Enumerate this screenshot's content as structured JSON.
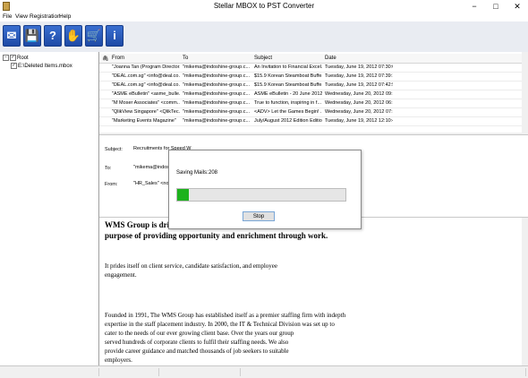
{
  "window": {
    "title": "Stellar MBOX to PST Converter",
    "minimize": "−",
    "maximize": "□",
    "close": "✕"
  },
  "menu": [
    "File",
    "View",
    "Registration",
    "Help"
  ],
  "toolbar": [
    {
      "name": "email-icon",
      "glyph": "✉"
    },
    {
      "name": "save-icon",
      "glyph": "💾"
    },
    {
      "name": "help-icon",
      "glyph": "?"
    },
    {
      "name": "hand-icon",
      "glyph": "✋"
    },
    {
      "name": "cart-icon",
      "glyph": "🛒"
    },
    {
      "name": "info-icon",
      "glyph": "i"
    }
  ],
  "tree": {
    "root": "Root",
    "child": "E:\\Deleted Items.mbox"
  },
  "list": {
    "columns": [
      "From",
      "To",
      "Subject",
      "Date"
    ],
    "rows": [
      [
        "\"Joanna Tan (Program Director...",
        "\"mikema@indoshine-group.c...",
        "An Invitation to Financial Excel...",
        "Tuesday, June 19, 2012 07:30:08"
      ],
      [
        "\"DEAL.com.sg\" <info@deal.co...",
        "\"mikema@indoshine-group.c...",
        "$15.9 Korean Steamboat Buffe...",
        "Tuesday, June 19, 2012 07:39:19"
      ],
      [
        "\"DEAL.com.sg\" <info@deal.co...",
        "\"mikema@indoshine-group.c...",
        "$15.9 Korean Steamboat Buffe...",
        "Tuesday, June 19, 2012 07:42:59"
      ],
      [
        "\"ASME eBulletin\" <asme_bulle...",
        "\"mikema@indoshine-group.c...",
        "ASME eBulletin - 20 June 2012",
        "Wednesday, June 20, 2012 09:5..."
      ],
      [
        "\"M Moser Associates\" <comm...",
        "\"mikema@indoshine-group.c...",
        "True to function, inspiring in f...",
        "Wednesday, June 20, 2012 06:3..."
      ],
      [
        "\"QlikView Singapore\" <QlikTec...",
        "\"mikema@indoshine-group.c...",
        "<ADV> Let the Games Begin! ...",
        "Wednesday, June 20, 2012 07:3..."
      ],
      [
        "\"Marketing Events Magazine\"",
        "\"mikema@indoshine-group.c...",
        "July/August 2012 Edition Editio...",
        "Tuesday, June 19, 2012 12:10:43"
      ]
    ]
  },
  "preview": {
    "subject_label": "Subject:",
    "subject_value": "Recruitments for Speed W",
    "to_label": "To:",
    "to_value": "\"mikema@indoshine",
    "from_label": "From:",
    "from_value": "\"HR_Sales\" <noreply"
  },
  "body": {
    "heading1": "WMS Group is driven by passion and a single",
    "heading2": "purpose of providing opportunity and enrichment through work.",
    "p1a": "It prides itself on client service, candidate satisfaction, and employee",
    "p1b": "engagement.",
    "p2a": "Founded in 1991, The WMS Group has established itself as a premier staffing firm with indepth",
    "p2b": "expertise in the staff placement industry. In 2000, the IT & Technical Division was set up to",
    "p2c": "cater to the needs of our ever growing client base. Over the years our group",
    "p2d": "served hundreds of corporate clients to fulfil their staffing needs. We also",
    "p2e": "provide career guidance and matched thousands of job seekers to suitable",
    "p2f": "employers."
  },
  "dialog": {
    "label": "Saving Mails:",
    "count": "208",
    "progress": 0.07,
    "stop": "Stop"
  },
  "colors": {
    "progress": "#1db21d",
    "toolbar_button": "#2a5cc0"
  }
}
